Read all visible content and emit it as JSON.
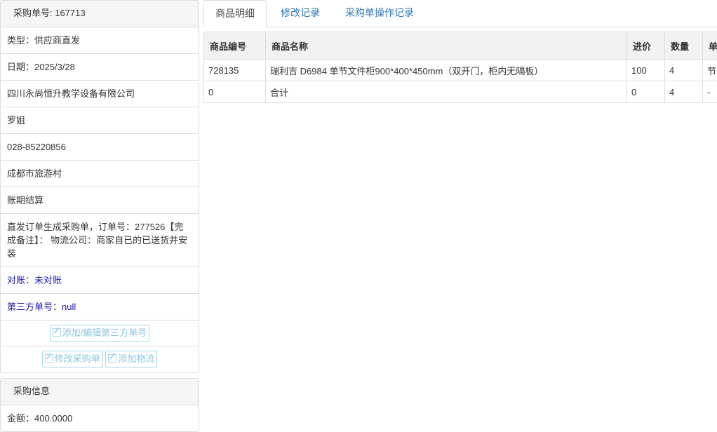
{
  "order_panel": {
    "heading": "采购单号: 167713",
    "rows": [
      "类型：供应商直发",
      "日期：2025/3/28",
      "四川永尚恒升教学设备有限公司",
      "罗姐",
      "028-85220856",
      "成都市旅游村",
      "账期结算",
      "直发订单生成采购单，订单号：277526【完成备注】： 物流公司：商家自已的已送货并安装"
    ],
    "reconcile": "对账：未对账",
    "third_party_no": "第三方单号：null",
    "btn_third_party": "添加/编辑第三方单号",
    "btn_edit_order": "修改采购单",
    "btn_add_logistics": "添加物流"
  },
  "purchase_panel": {
    "heading": "采购信息",
    "amount": "金额：400.0000"
  },
  "tabs": [
    "商品明细",
    "修改记录",
    "采购单操作记录"
  ],
  "table": {
    "headers": [
      "商品编号",
      "商品名称",
      "进价",
      "数量",
      "单"
    ],
    "rows": [
      [
        "728135",
        "瑞利吉 D6984 单节文件柜900*400*450mm（双开门，柜内无隔板）",
        "100",
        "4",
        "节"
      ],
      [
        "0",
        "合计",
        "0",
        "4",
        "-"
      ]
    ]
  }
}
